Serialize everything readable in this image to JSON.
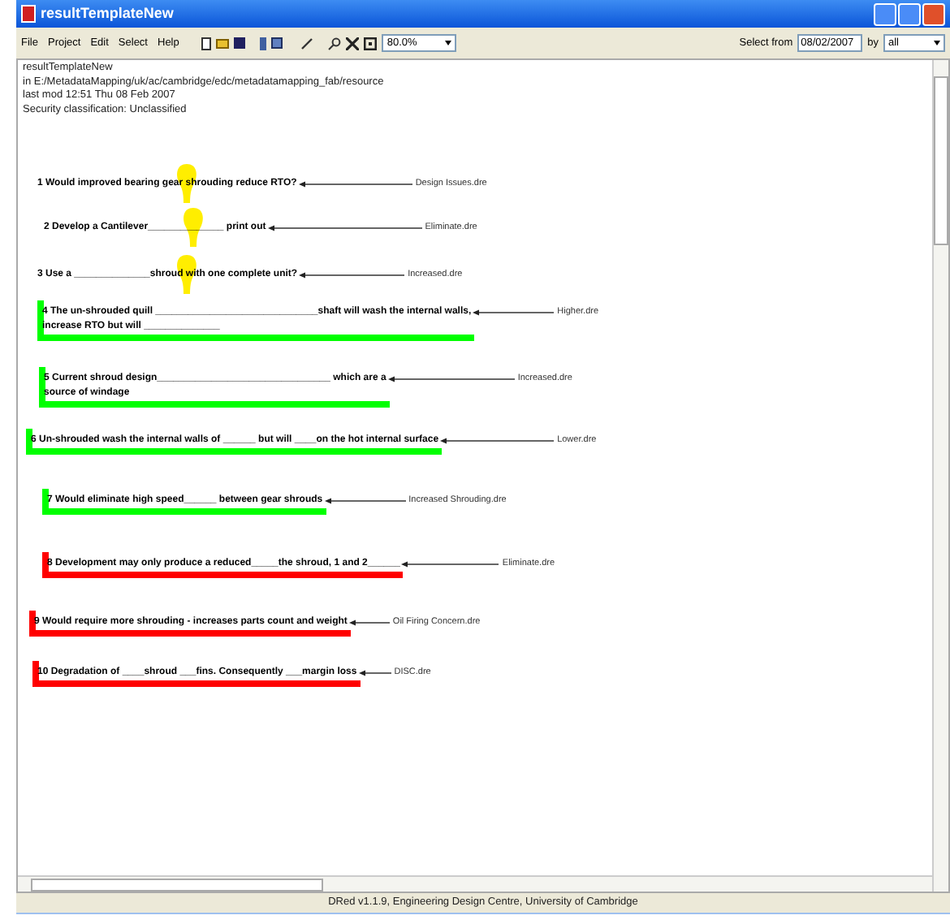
{
  "window": {
    "title": "resultTemplateNew"
  },
  "menu": [
    "File",
    "Project",
    "Edit",
    "Select",
    "Help"
  ],
  "toolbar": {
    "zoom": "80.0%",
    "select_from_label": "Select from",
    "select_from_value": "08/02/2007",
    "by_label": "by",
    "by_value": "all"
  },
  "header": [
    "resultTemplateNew",
    "in E:/MetadataMapping/uk/ac/cambridge/edc/metadatamapping_fab/resource",
    "last mod 12:51 Thu 08 Feb 2007",
    "Security classification: Unclassified"
  ],
  "items": [
    {
      "lines": [
        "1 Would improved bearing gear shrouding reduce RTO?"
      ],
      "target": "Design Issues.dre",
      "marker": {
        "kind": "bulb"
      }
    },
    {
      "lines": [
        "2 Develop a Cantilever______________ print out"
      ],
      "target": "Eliminate.dre",
      "marker": {
        "kind": "bulb"
      }
    },
    {
      "lines": [
        "3 Use a ______________shroud with one complete unit?"
      ],
      "target": "Increased.dre",
      "marker": {
        "kind": "bulb"
      }
    },
    {
      "lines": [
        "4 The un-shrouded quill ______________________________shaft will wash the internal walls,",
        "increase RTO but will ______________"
      ],
      "target": "Higher.dre",
      "marker": {
        "kind": "bracket",
        "color": "#00ff00"
      }
    },
    {
      "lines": [
        "5 Current shroud design________________________________ which are a",
        "source of windage"
      ],
      "target": "Increased.dre",
      "marker": {
        "kind": "bracket",
        "color": "#00ff00"
      }
    },
    {
      "lines": [
        "6 Un-shrouded wash the internal walls of ______ but will ____on the hot internal surface"
      ],
      "target": "Lower.dre",
      "marker": {
        "kind": "bracket",
        "color": "#00ff00"
      }
    },
    {
      "lines": [
        "7 Would eliminate high speed______ between gear shrouds"
      ],
      "target": "Increased Shrouding.dre",
      "marker": {
        "kind": "bracket",
        "color": "#00ff00"
      }
    },
    {
      "lines": [
        "8 Development may only produce a reduced_____the shroud, 1 and 2______"
      ],
      "target": "Eliminate.dre",
      "marker": {
        "kind": "bracket",
        "color": "#ff0000"
      }
    },
    {
      "lines": [
        "9 Would require more shrouding - increases parts count and weight"
      ],
      "target": "Oil Firing Concern.dre",
      "marker": {
        "kind": "bracket",
        "color": "#ff0000"
      }
    },
    {
      "lines": [
        "10 Degradation of ____shroud ___fins. Consequently ___margin loss"
      ],
      "target": "DISC.dre",
      "marker": {
        "kind": "bracket",
        "color": "#ff0000"
      }
    }
  ],
  "status_bar": "DRed v1.1.9, Engineering Design Centre, University of Cambridge"
}
